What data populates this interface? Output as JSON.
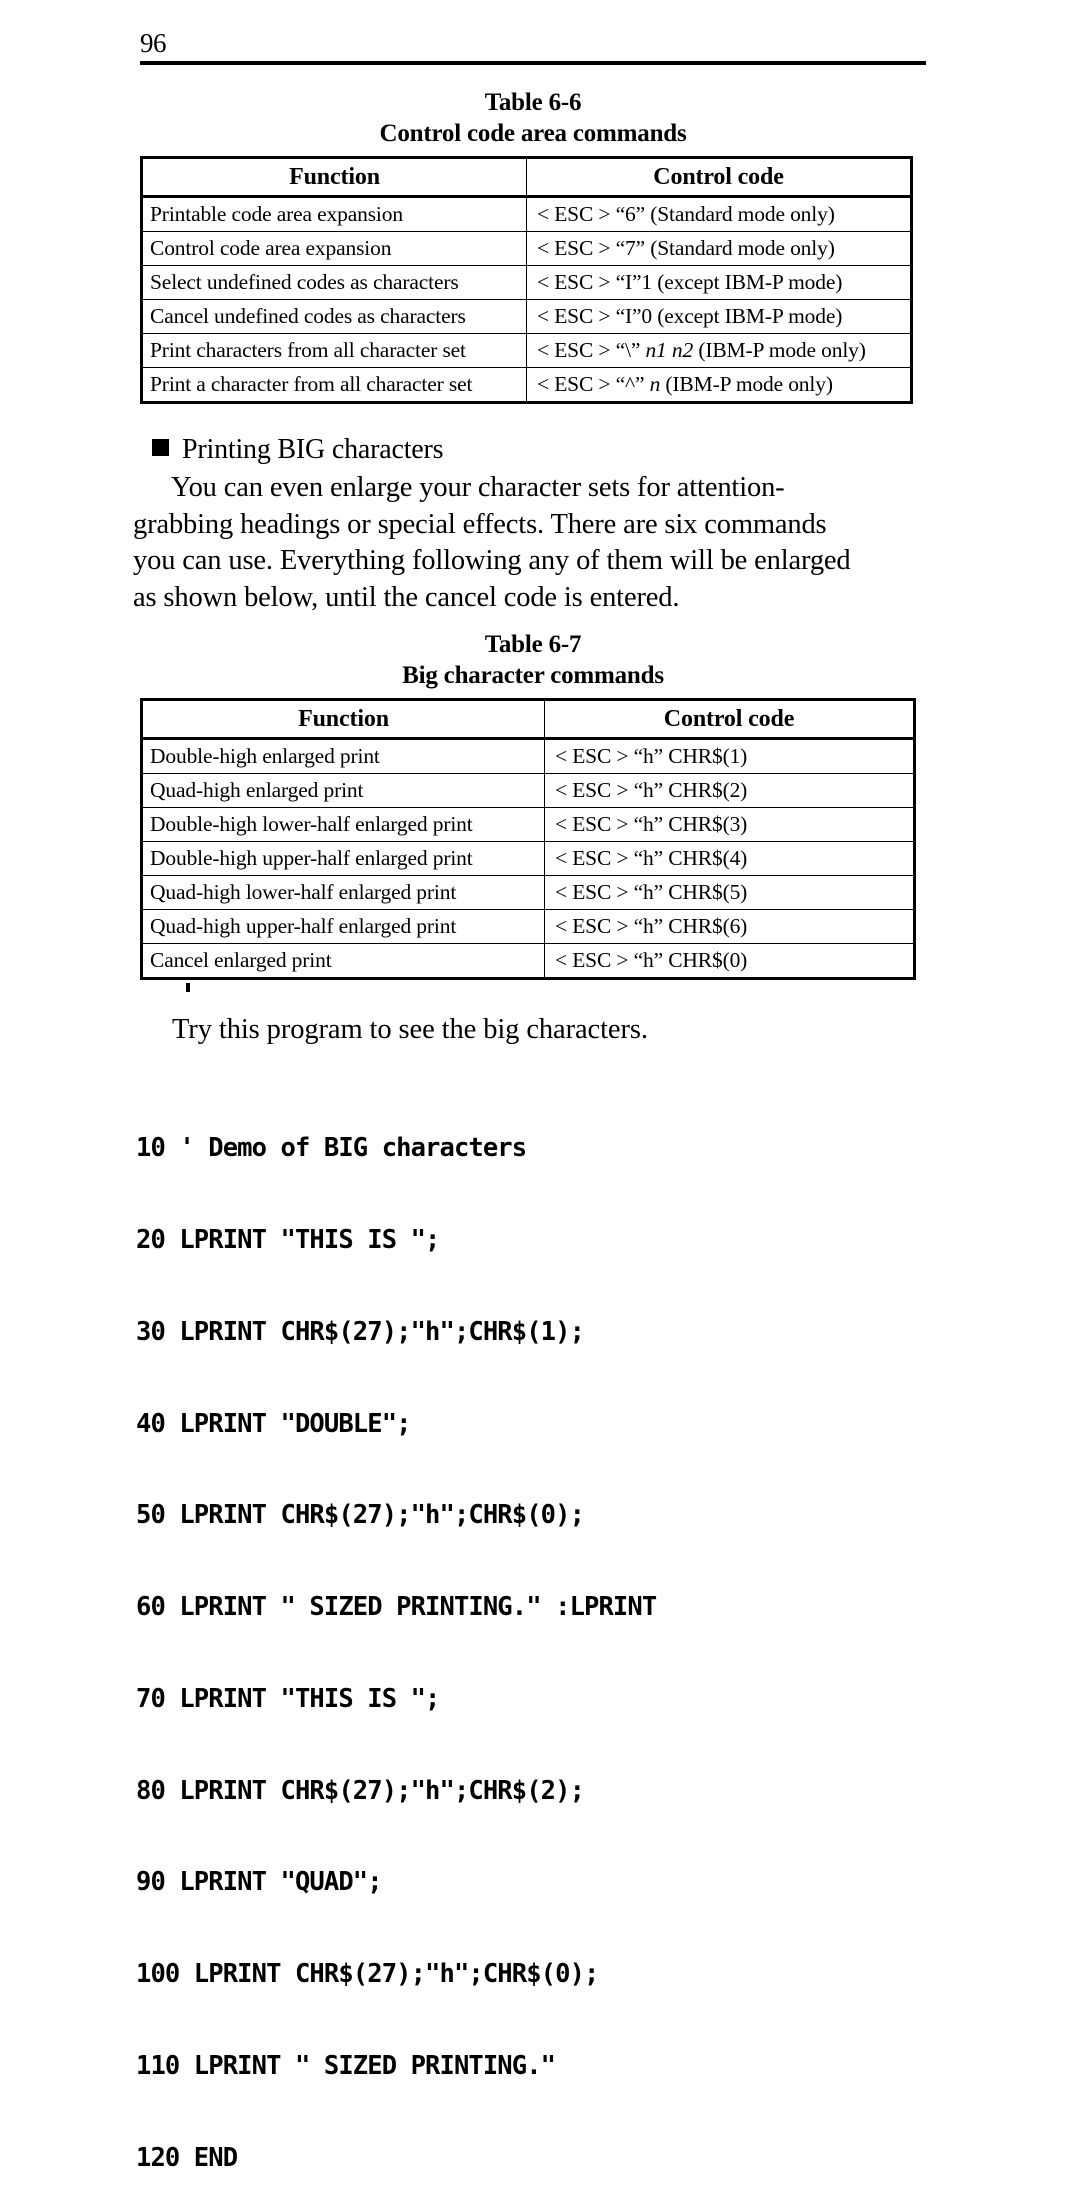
{
  "page": {
    "number": "96"
  },
  "table_6_6": {
    "caption_line1": "Table 6-6",
    "caption_line2": "Control code area commands",
    "headers": [
      "Function",
      "Control code"
    ],
    "rows": [
      {
        "function": "Printable code area expansion",
        "control_code": "< ESC > “6” (Standard mode only)"
      },
      {
        "function": "Control code area expansion",
        "control_code": "< ESC > “7” (Standard mode only)"
      },
      {
        "function": "Select undefined codes as characters",
        "control_code": "< ESC > “I”1 (except IBM-P mode)"
      },
      {
        "function": "Cancel undefined codes as characters",
        "control_code": "< ESC > “I”0 (except IBM-P mode)"
      },
      {
        "function": "Print characters from all character set",
        "control_code_prefix": "< ESC > “\\” ",
        "control_code_italic": "n1 n2",
        "control_code_suffix": " (IBM-P mode only)"
      },
      {
        "function": "Print a character from all character set",
        "control_code_prefix": "< ESC > “^” ",
        "control_code_italic": "n",
        "control_code_suffix": " (IBM-P mode only)"
      }
    ]
  },
  "section": {
    "heading": "Printing BIG characters",
    "paragraph_lines": [
      "You   can   even   enlarge   your   character   sets   for   attention-",
      "grabbing headings or special effects. There are six commands",
      "you can use. Everything following any of them will be enlarged",
      "as shown below, until the cancel code is entered."
    ]
  },
  "table_6_7": {
    "caption_line1": "Table 6-7",
    "caption_line2": "Big character commands",
    "headers": [
      "Function",
      "Control code"
    ],
    "rows": [
      {
        "function": "Double-high enlarged print",
        "control_code": "< ESC > “h” CHR$(1)"
      },
      {
        "function": "Quad-high enlarged print",
        "control_code": "< ESC > “h” CHR$(2)"
      },
      {
        "function": "Double-high lower-half enlarged print",
        "control_code": "< ESC > “h” CHR$(3)"
      },
      {
        "function": "Double-high upper-half enlarged print",
        "control_code": "< ESC > “h” CHR$(4)"
      },
      {
        "function": "Quad-high lower-half enlarged print",
        "control_code": "< ESC > “h” CHR$(5)"
      },
      {
        "function": "Quad-high upper-half enlarged print",
        "control_code": "< ESC > “h” CHR$(6)"
      },
      {
        "function": "Cancel enlarged print",
        "control_code": "< ESC > “h” CHR$(0)"
      }
    ]
  },
  "program": {
    "intro": "Try this program to see the big characters.",
    "lines": [
      "10 ' Demo of BIG characters",
      "20 LPRINT \"THIS IS \";",
      "30 LPRINT CHR$(27);\"h\";CHR$(1);",
      "40 LPRINT \"DOUBLE\";",
      "50 LPRINT CHR$(27);\"h\";CHR$(0);",
      "60 LPRINT \" SIZED PRINTING.\" :LPRINT",
      "70 LPRINT \"THIS IS \";",
      "80 LPRINT CHR$(27);\"h\";CHR$(2);",
      "90 LPRINT \"QUAD\";",
      "100 LPRINT CHR$(27);\"h\";CHR$(0);",
      "110 LPRINT \" SIZED PRINTING.\"",
      "120 END"
    ]
  }
}
